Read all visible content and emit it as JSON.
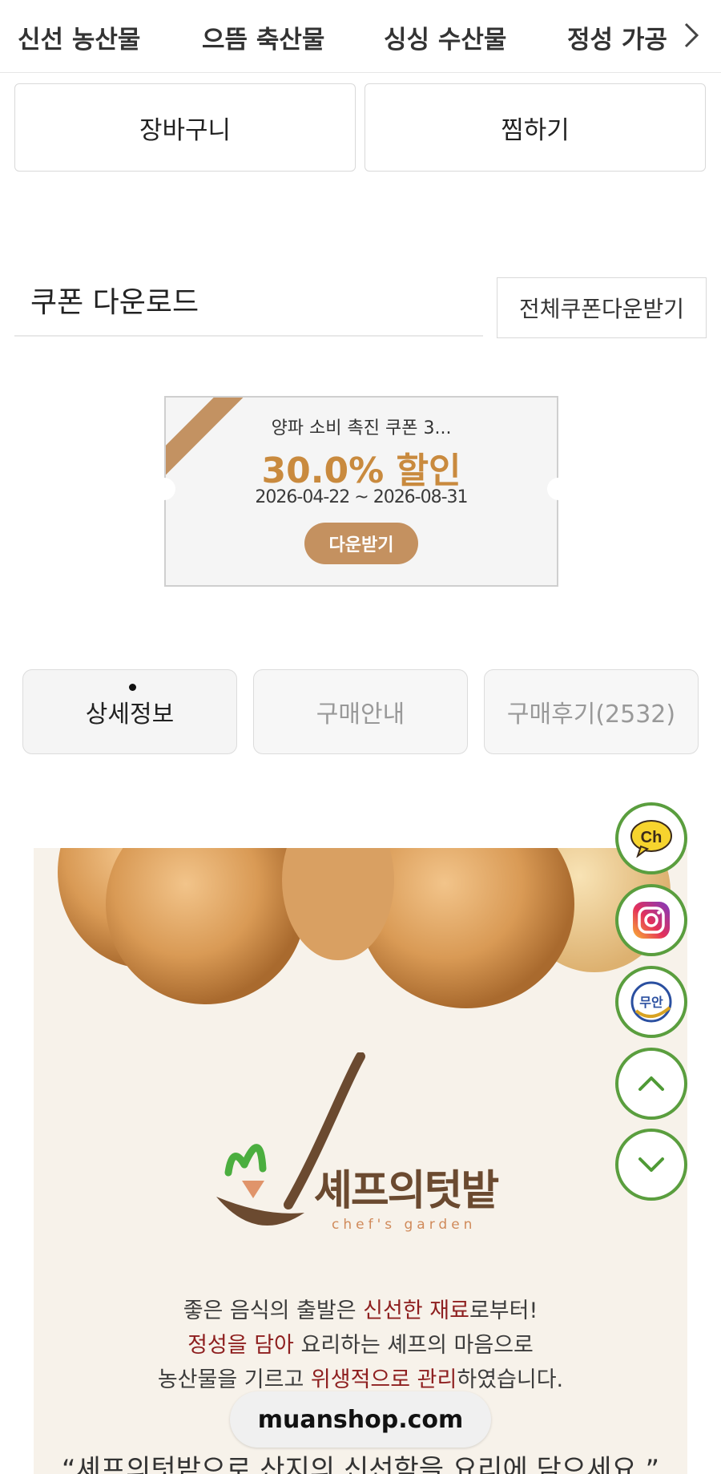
{
  "category_nav": {
    "items": [
      "신선 농산물",
      "으뜸 축산물",
      "싱싱 수산물",
      "정성 가공"
    ]
  },
  "actions": {
    "cart_label": "장바구니",
    "wish_label": "찜하기"
  },
  "coupon": {
    "section_title": "쿠폰 다운로드",
    "download_all_label": "전체쿠폰다운받기",
    "card": {
      "name": "양파 소비 촉진 쿠폰 3...",
      "discount": "30.0% 할인",
      "period": "2026-04-22 ~ 2026-08-31",
      "download_label": "다운받기",
      "accent_color": "#c49160"
    }
  },
  "tabs": [
    {
      "label": "상세정보",
      "active": true
    },
    {
      "label": "구매안내",
      "active": false
    },
    {
      "label": "구매후기(2532)",
      "active": false
    }
  ],
  "product_image": {
    "logo_text": "셰프의텃밭",
    "logo_subtext": "chef's garden",
    "lines": [
      [
        "좋은 음식의 출발은 ",
        "신선한 재료",
        "로부터!"
      ],
      [
        "",
        "정성을 담아",
        " 요리하는 셰프의 마음으로"
      ],
      [
        "농산물을 기르고 ",
        "위생적으로 관리",
        "하였습니다."
      ]
    ],
    "quote": "“셰프의텃밭으로 산지의 신선함을 요리에 담으세요.”"
  },
  "floating": {
    "kakao_label": "Ch",
    "brand_label": "무안",
    "icons": [
      "kakao-channel-icon",
      "instagram-icon",
      "muan-brand-icon",
      "scroll-up-icon",
      "scroll-down-icon"
    ]
  },
  "url_bar": {
    "domain": "muanshop.com"
  }
}
